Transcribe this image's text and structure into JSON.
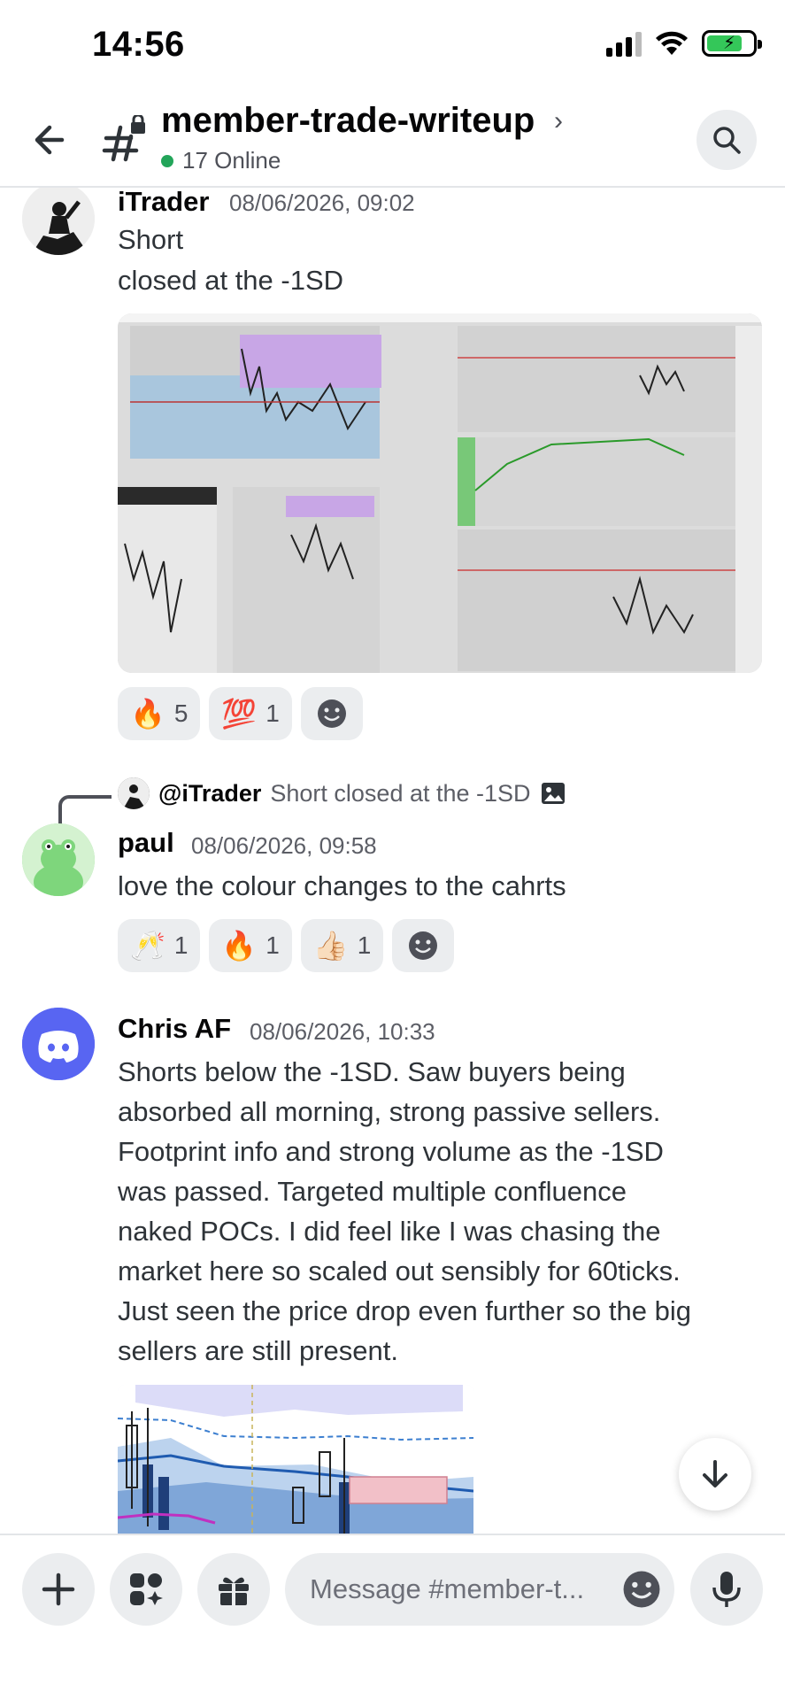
{
  "status_bar": {
    "time": "14:56"
  },
  "header": {
    "channel_name": "member-trade-writeup",
    "online_count": "17 Online"
  },
  "messages": [
    {
      "author": "iTrader",
      "timestamp": "08/06/2026, 09:02",
      "lines": [
        "Short",
        "closed at the -1SD"
      ],
      "reactions": [
        {
          "emoji": "🔥",
          "count": "5"
        },
        {
          "emoji": "💯",
          "count": "1"
        }
      ]
    },
    {
      "reply_to": {
        "author": "@iTrader",
        "text": "Short  closed at the -1SD"
      },
      "author": "paul",
      "timestamp": "08/06/2026, 09:58",
      "lines": [
        "love the colour changes to the cahrts"
      ],
      "reactions": [
        {
          "emoji": "🥂",
          "count": "1"
        },
        {
          "emoji": "🔥",
          "count": "1"
        },
        {
          "emoji": "👍🏻",
          "count": "1"
        }
      ]
    },
    {
      "author": "Chris AF",
      "timestamp": "08/06/2026, 10:33",
      "lines": [
        "Shorts below the -1SD.  Saw buyers being",
        "absorbed all morning, strong passive sellers.",
        "Footprint info and strong volume as the -1SD",
        "was passed.  Targeted multiple confluence",
        "naked POCs.  I did feel like I was chasing the",
        "market here so scaled out sensibly for 60ticks.",
        "Just seen the price drop even further so the big",
        "sellers are still present."
      ]
    }
  ],
  "composer": {
    "placeholder": "Message #member-t..."
  },
  "icons": {
    "back": "arrow-left-icon",
    "channel": "locked-hashtag-icon",
    "search": "search-icon",
    "scroll_down": "arrow-down-icon",
    "add": "plus-icon",
    "apps": "apps-icon",
    "gift": "gift-icon",
    "emoji": "smiley-icon",
    "mic": "microphone-icon"
  },
  "colors": {
    "online": "#23a55a",
    "discord_blurple": "#5865f2",
    "paul_avatar": "#7ed67c"
  }
}
